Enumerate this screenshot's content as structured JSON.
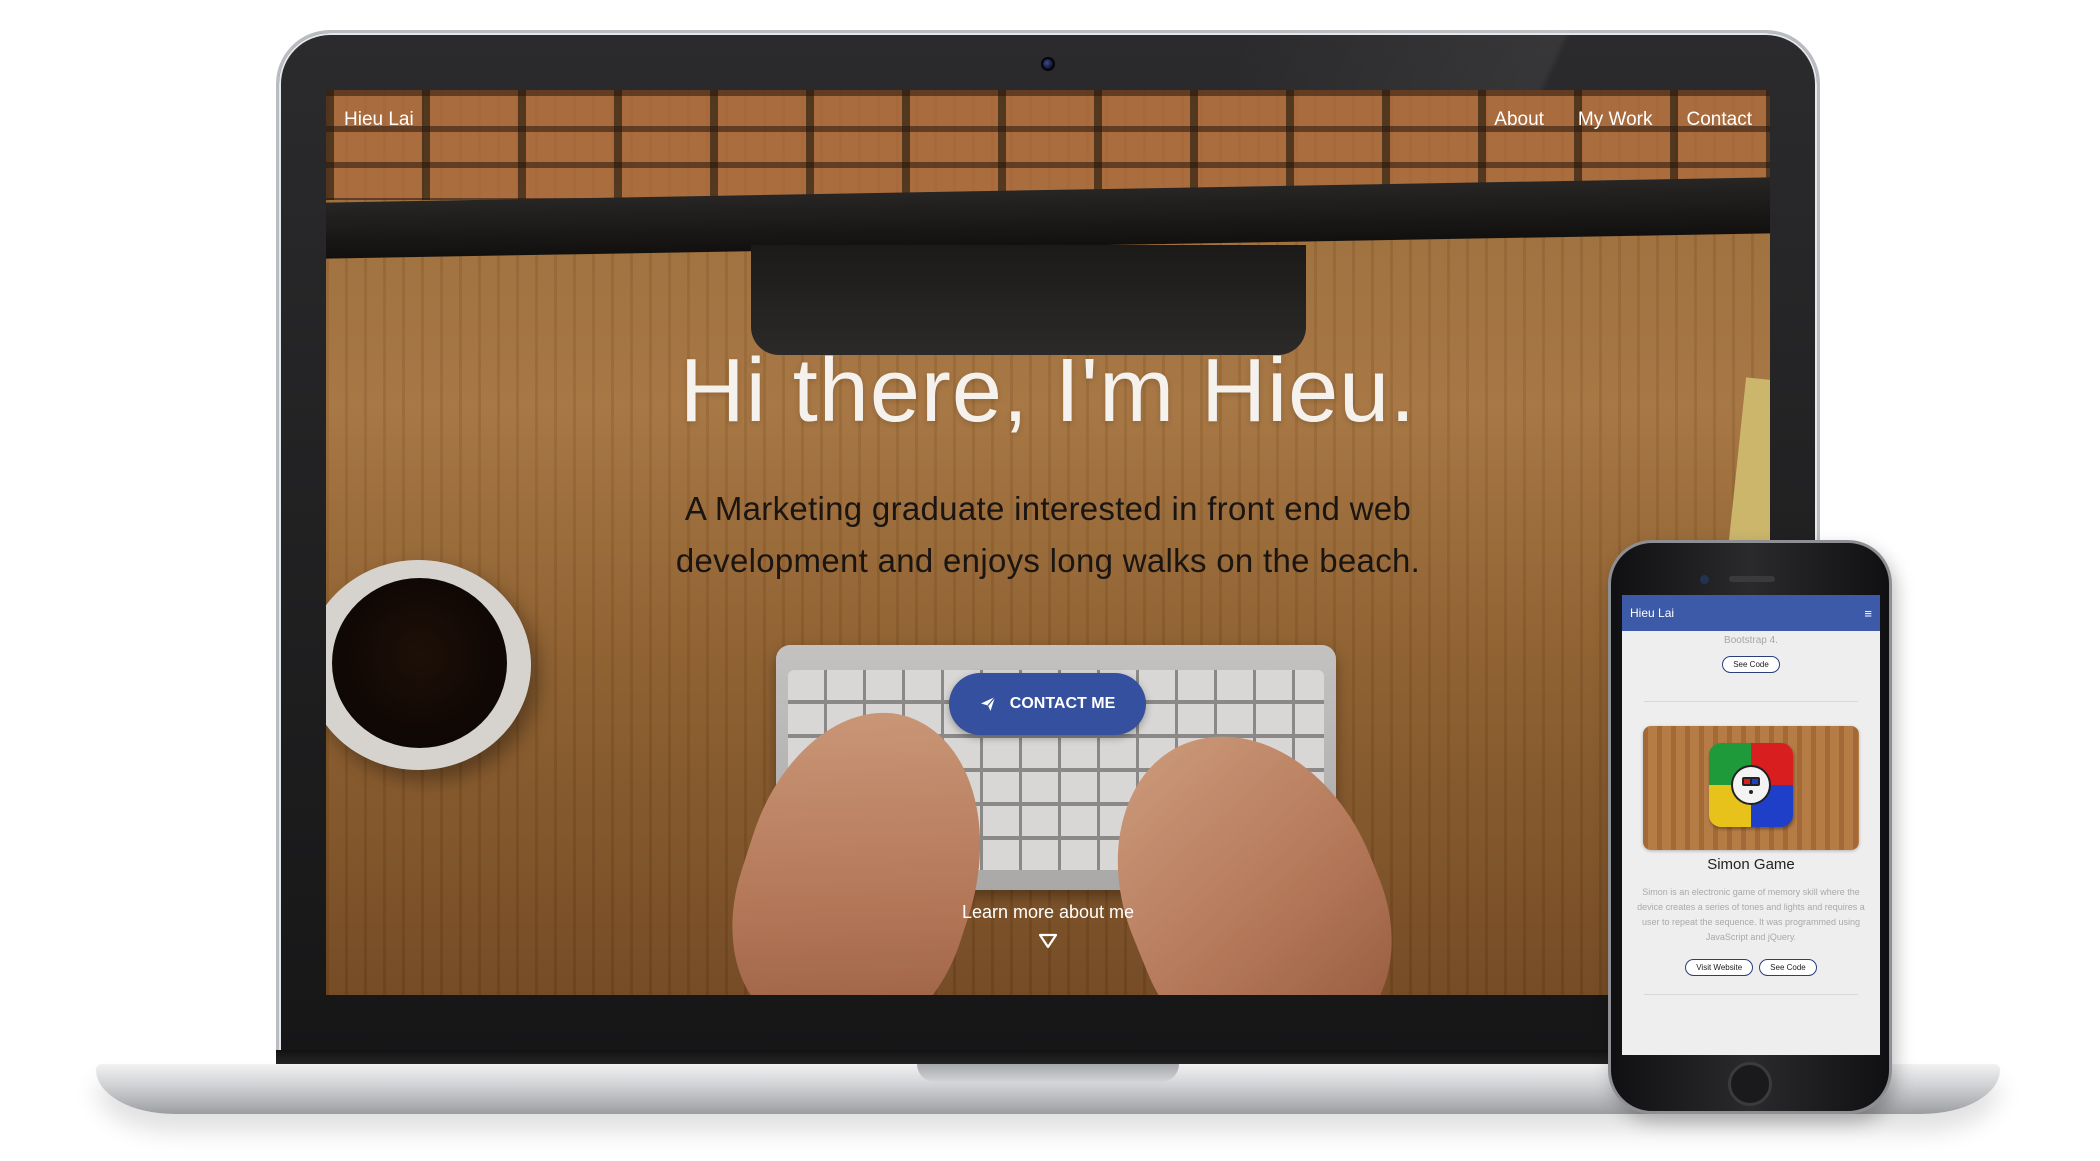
{
  "laptop_site": {
    "nav": {
      "brand": "Hieu Lai",
      "links": [
        "About",
        "My Work",
        "Contact"
      ]
    },
    "hero": {
      "title": "Hi there, I'm Hieu.",
      "subtitle_line1": "A Marketing graduate interested in front end web",
      "subtitle_line2": "development and enjoys long walks on the beach.",
      "cta_label": "CONTACT ME",
      "cta_icon": "paper-plane-icon",
      "learn_more": "Learn more about me",
      "learn_more_icon": "triangle-down-icon"
    }
  },
  "phone_site": {
    "nav": {
      "brand": "Hieu Lai",
      "menu_icon": "hamburger-icon",
      "menu_glyph": "≡"
    },
    "prev_item": {
      "text": "Bootstrap 4.",
      "code_button": "See Code"
    },
    "card": {
      "title": "Simon Game",
      "description": "Simon is an electronic game of memory skill where the device creates a series of tones and lights and requires a user to repeat the sequence. It was programmed using JavaScript and jQuery.",
      "visit_button": "Visit Website",
      "code_button": "See Code",
      "image_icon": "simon-game-icon"
    }
  },
  "colors": {
    "accent": "#3650a0",
    "phone_nav": "#3d5aa8",
    "simon_green": "#1f9a3a",
    "simon_red": "#d81e1e",
    "simon_yellow": "#e6c21a",
    "simon_blue": "#1f3fc8"
  }
}
